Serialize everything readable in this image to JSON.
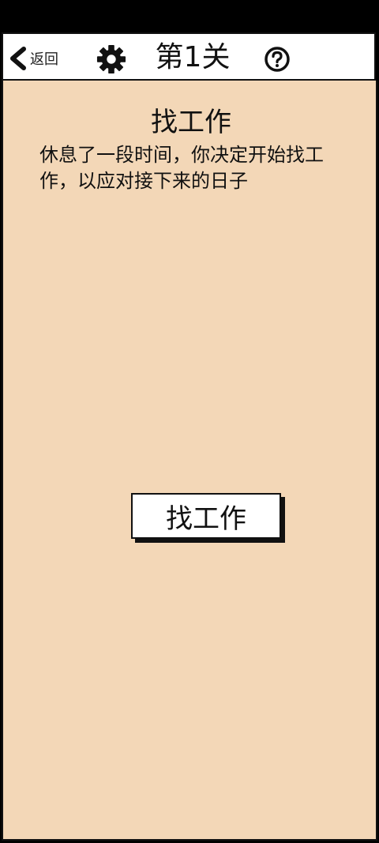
{
  "header": {
    "back_label": "返回",
    "level_title": "第1关",
    "icons": {
      "back": "chevron-left-icon",
      "settings": "gear-icon",
      "help": "question-circle-icon"
    }
  },
  "scene": {
    "title": "找工作",
    "description": "休息了一段时间，你决定开始找工作，以应对接下来的日子",
    "action_label": "找工作"
  },
  "colors": {
    "background": "#f3d7b7",
    "header_bg": "#ffffff",
    "outline": "#111111",
    "outer": "#000000"
  }
}
